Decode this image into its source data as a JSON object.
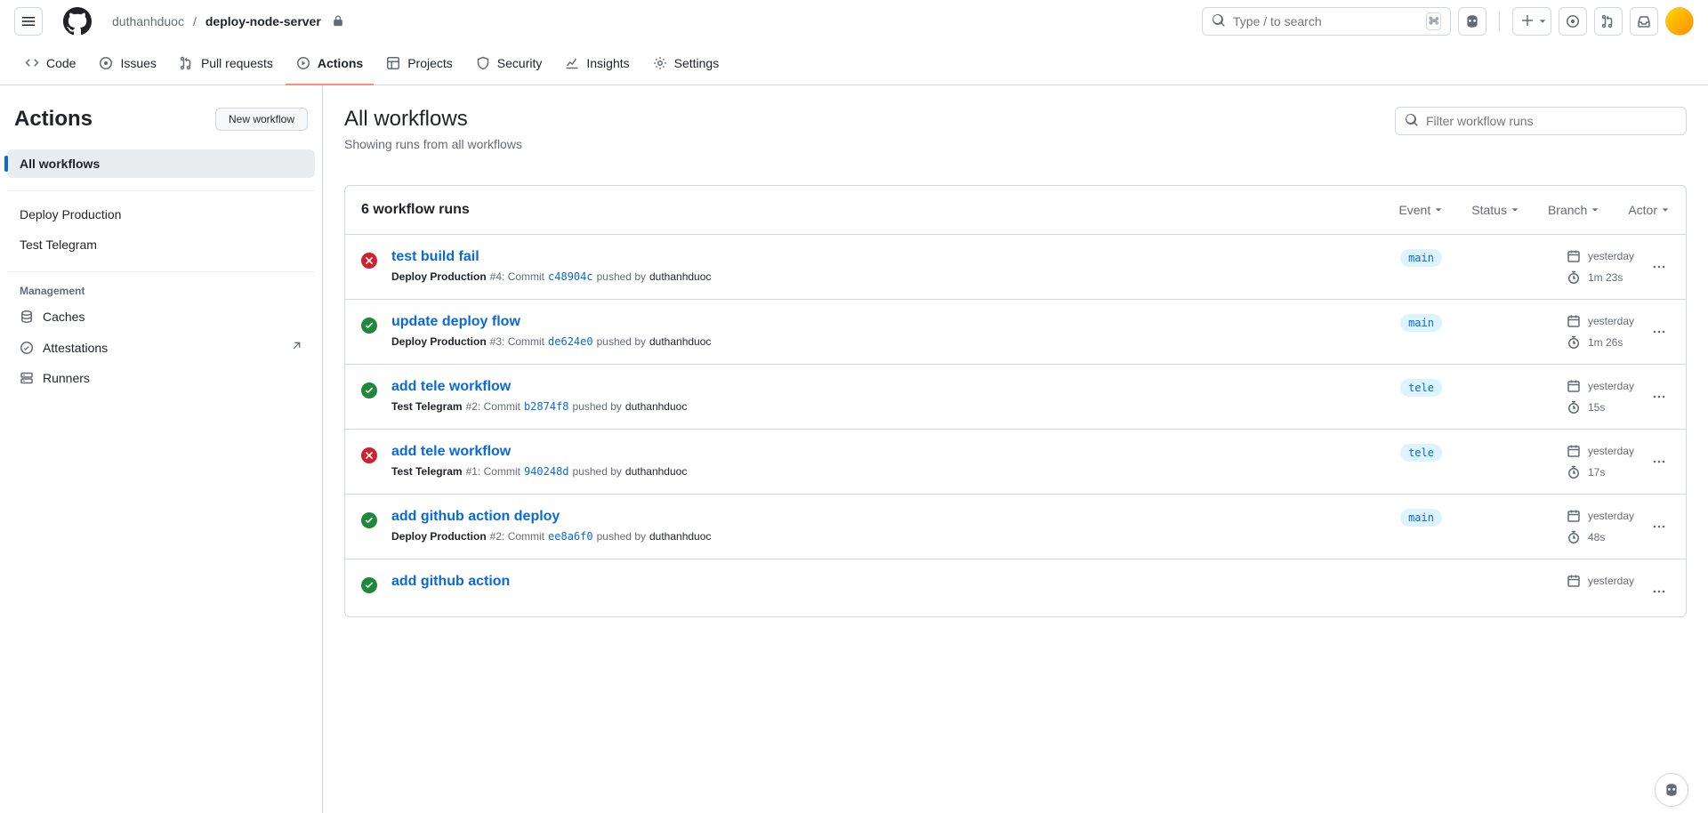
{
  "header": {
    "owner": "duthanhduoc",
    "repo": "deploy-node-server",
    "search_placeholder": "Type / to search",
    "nav": {
      "code": "Code",
      "issues": "Issues",
      "pulls": "Pull requests",
      "actions": "Actions",
      "projects": "Projects",
      "security": "Security",
      "insights": "Insights",
      "settings": "Settings"
    }
  },
  "left": {
    "title": "Actions",
    "new_label": "New workflow",
    "nav": {
      "all": "All workflows",
      "wf1": "Deploy Production",
      "wf2": "Test Telegram",
      "management_label": "Management",
      "caches": "Caches",
      "attestations": "Attestations",
      "runners": "Runners"
    }
  },
  "main": {
    "title": "All workflows",
    "subtitle": "Showing runs from all workflows",
    "filter_placeholder": "Filter workflow runs",
    "count_label": "6 workflow runs",
    "filters": {
      "event": "Event",
      "status": "Status",
      "branch": "Branch",
      "actor": "Actor"
    }
  },
  "runs": [
    {
      "status": "fail",
      "title": "test build fail",
      "wf": "Deploy Production",
      "runref": " #4: Commit ",
      "sha": "c48904c",
      "pushed": " pushed by ",
      "actor": "duthanhduoc",
      "branch": "main",
      "date": "yesterday",
      "duration": "1m 23s"
    },
    {
      "status": "ok",
      "title": "update deploy flow",
      "wf": "Deploy Production",
      "runref": " #3: Commit ",
      "sha": "de624e0",
      "pushed": " pushed by ",
      "actor": "duthanhduoc",
      "branch": "main",
      "date": "yesterday",
      "duration": "1m 26s"
    },
    {
      "status": "ok",
      "title": "add tele workflow",
      "wf": "Test Telegram",
      "runref": " #2: Commit ",
      "sha": "b2874f8",
      "pushed": " pushed by ",
      "actor": "duthanhduoc",
      "branch": "tele",
      "date": "yesterday",
      "duration": "15s"
    },
    {
      "status": "fail",
      "title": "add tele workflow",
      "wf": "Test Telegram",
      "runref": " #1: Commit ",
      "sha": "940248d",
      "pushed": " pushed by ",
      "actor": "duthanhduoc",
      "branch": "tele",
      "date": "yesterday",
      "duration": "17s"
    },
    {
      "status": "ok",
      "title": "add github action deploy",
      "wf": "Deploy Production",
      "runref": " #2: Commit ",
      "sha": "ee8a6f0",
      "pushed": " pushed by ",
      "actor": "duthanhduoc",
      "branch": "main",
      "date": "yesterday",
      "duration": "48s"
    },
    {
      "status": "ok",
      "title": "add github action",
      "wf": "",
      "runref": "",
      "sha": "",
      "pushed": "",
      "actor": "",
      "branch": "",
      "date": "yesterday",
      "duration": ""
    }
  ]
}
